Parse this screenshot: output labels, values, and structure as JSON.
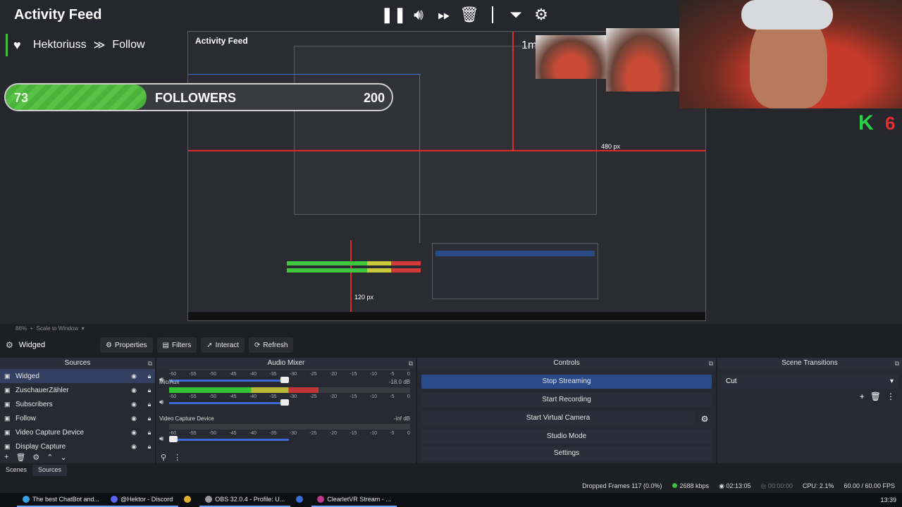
{
  "overlay": {
    "title": "Activity Feed",
    "event": {
      "user": "Hektoriuss",
      "action": "Follow"
    },
    "goal": {
      "current": "73",
      "label": "FOLLOWERS",
      "target": "200",
      "fraction": 0.365
    },
    "timer": "1m",
    "nested_dim_1": "480 px",
    "nested_dim_2": "120 px",
    "k_badge": "K",
    "k_number": "6",
    "colors": {
      "accent_green": "#57c246",
      "guide_red": "#e02a2a",
      "guide_blue": "#3a6fd6"
    }
  },
  "zoom": {
    "percent": "86%",
    "mode": "Scale to Window"
  },
  "source_toolbar": {
    "selected_source": "Widged",
    "properties": "Properties",
    "filters": "Filters",
    "interact": "Interact",
    "refresh": "Refresh"
  },
  "sources": {
    "title": "Sources",
    "items": [
      {
        "name": "Widged"
      },
      {
        "name": "ZuschauerZähler"
      },
      {
        "name": "Subscribers"
      },
      {
        "name": "Follow"
      },
      {
        "name": "Video Capture Device"
      },
      {
        "name": "Display Capture"
      }
    ]
  },
  "mixer": {
    "title": "Audio Mixer",
    "channels": [
      {
        "name": "",
        "db": "",
        "level": 0.0
      },
      {
        "name": "Mic/Aux",
        "db": "-18.0 dB",
        "level": 0.62
      },
      {
        "name": "Video Capture Device",
        "db": "-inf dB",
        "level": 0.0
      }
    ],
    "ticks": [
      "-60",
      "-55",
      "-50",
      "-45",
      "-40",
      "-35",
      "-30",
      "-25",
      "-20",
      "-15",
      "-10",
      "-5",
      "0"
    ]
  },
  "controls": {
    "title": "Controls",
    "stop_streaming": "Stop Streaming",
    "start_recording": "Start Recording",
    "start_virtual_camera": "Start Virtual Camera",
    "studio_mode": "Studio Mode",
    "settings": "Settings"
  },
  "transitions": {
    "title": "Scene Transitions",
    "selected": "Cut"
  },
  "dock_tabs": {
    "scenes": "Scenes",
    "sources": "Sources"
  },
  "status": {
    "dropped": "Dropped Frames 117 (0.0%)",
    "bitrate": "2688 kbps",
    "stream_time": "02:13:05",
    "rec_time": "00:00:00",
    "cpu": "CPU: 2.1%",
    "fps": "60.00 / 60.00 FPS"
  },
  "taskbar": {
    "items": [
      {
        "label": "The best ChatBot and...",
        "color": "#3aa0e0"
      },
      {
        "label": "@Hektor - Discord",
        "color": "#5865f2"
      },
      {
        "label": "",
        "color": "#e0b030"
      },
      {
        "label": "OBS 32.0.4 - Profile: U...",
        "color": "#9a9aa0"
      },
      {
        "label": "",
        "color": "#3a6fd6"
      },
      {
        "label": "ClearletVR Stream - ...",
        "color": "#c03a8a"
      }
    ],
    "clock": "13:39"
  }
}
